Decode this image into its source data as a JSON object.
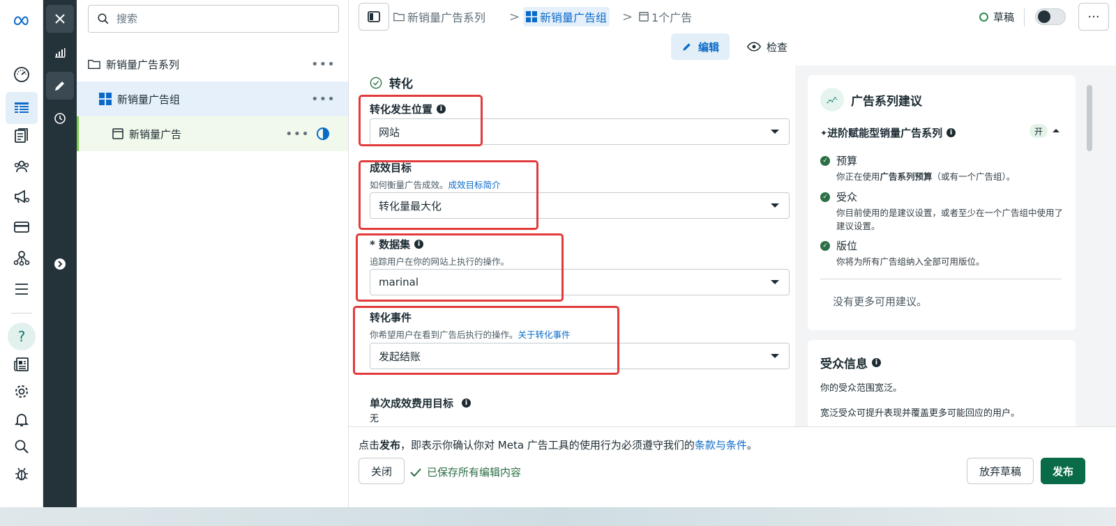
{
  "colors": {
    "accent": "#0a6ac8",
    "primary_button": "#0a6b48",
    "highlight_box": "#e23a3a",
    "dark_bar": "#243239",
    "success": "#2c6e46"
  },
  "nav": {
    "icons": [
      "meta-logo-icon",
      "dashboard-icon",
      "table-icon",
      "pages-icon",
      "audience-icon",
      "megaphone-icon",
      "billing-icon",
      "network-icon",
      "menu-icon",
      "help-icon",
      "news-icon",
      "settings-icon",
      "bell-icon",
      "search-icon",
      "bug-icon"
    ],
    "help_label": "?"
  },
  "darkbar": {
    "icons": [
      "close-icon",
      "chart-icon",
      "edit-icon",
      "history-icon",
      "expand-icon"
    ]
  },
  "tree": {
    "search_placeholder": "搜索",
    "campaign": "新销量广告系列",
    "adset": "新销量广告组",
    "ad": "新销量广告",
    "more": "•••"
  },
  "topbar": {
    "crumbs": [
      "新销量广告系列",
      "新销量广告组",
      "1个广告"
    ],
    "separator": ">",
    "status": "草稿",
    "more": "···"
  },
  "modes": {
    "edit": "编辑",
    "view": "检查"
  },
  "form": {
    "section_title": "转化",
    "location": {
      "label": "转化发生位置",
      "value": "网站"
    },
    "goal": {
      "label": "成效目标",
      "desc": "如何衡量广告成效。",
      "link": "成效目标简介",
      "value": "转化量最大化"
    },
    "dataset": {
      "label": "* 数据集",
      "desc": "追踪用户在你的网站上执行的操作。",
      "value": "marinal"
    },
    "event": {
      "label": "转化事件",
      "desc": "你希望用户在看到广告后执行的操作。",
      "link": "关于转化事件",
      "value": "发起结账"
    },
    "cost": {
      "label": "单次成效费用目标",
      "value": "无"
    }
  },
  "suggestions": {
    "title": "广告系列建议",
    "advantage": "进阶赋能型销量广告系列",
    "advantage_spark": "✦",
    "on": "开",
    "items": [
      {
        "title": "预算",
        "desc_pre": "你正在使用",
        "desc_bold": "广告系列预算",
        "desc_post": "（或有一个广告组）。"
      },
      {
        "title": "受众",
        "desc": "你目前使用的是建议设置，或者至少在一个广告组中使用了建议设置。"
      },
      {
        "title": "版位",
        "desc": "你将为所有广告组纳入全部可用版位。"
      }
    ],
    "none_more": "没有更多可用建议。"
  },
  "audience": {
    "title": "受众信息",
    "line1": "你的受众范围宽泛。",
    "line2": "宽泛受众可提升表现并覆盖更多可能回应的用户。"
  },
  "footer": {
    "terms_pre": "点击",
    "terms_bold": "发布",
    "terms_mid": "，即表示你确认你对 Meta 广告工具的使用行为必须遵守我们的",
    "terms_link": "条款与条件",
    "terms_end": "。",
    "close": "关闭",
    "saved": "已保存所有编辑内容",
    "discard": "放弃草稿",
    "publish": "发布"
  }
}
